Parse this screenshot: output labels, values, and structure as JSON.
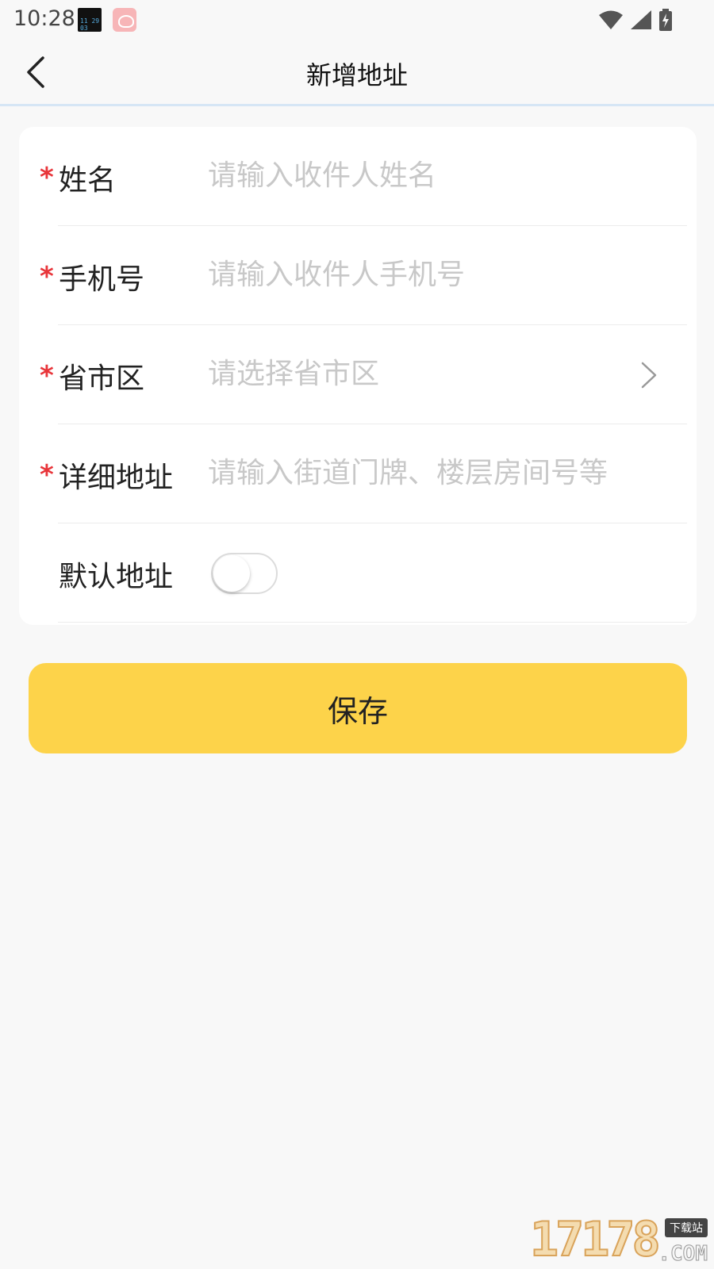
{
  "status_bar": {
    "time": "10:28",
    "icons": [
      "clock-widget-icon",
      "app-icon",
      "wifi-icon",
      "signal-icon",
      "battery-charging-icon"
    ]
  },
  "nav": {
    "title": "新增地址",
    "back_icon": "chevron-left-icon"
  },
  "form": {
    "name": {
      "label": "姓名",
      "required_mark": "*",
      "value": "",
      "placeholder": "请输入收件人姓名"
    },
    "phone": {
      "label": "手机号",
      "required_mark": "*",
      "value": "",
      "placeholder": "请输入收件人手机号"
    },
    "region": {
      "label": "省市区",
      "required_mark": "*",
      "value": "",
      "placeholder": "请选择省市区"
    },
    "detail": {
      "label": "详细地址",
      "required_mark": "*",
      "value": "",
      "placeholder": "请输入街道门牌、楼层房间号等"
    },
    "default_address": {
      "label": "默认地址",
      "enabled": false
    }
  },
  "save_button": {
    "label": "保存",
    "color": "#fdd34a"
  },
  "watermark": {
    "number": "17178",
    "tag": "下载站",
    "suffix": ".COM"
  },
  "colors": {
    "required": "#e8353a",
    "placeholder": "#c8c8c8",
    "background": "#f8f8f8"
  }
}
